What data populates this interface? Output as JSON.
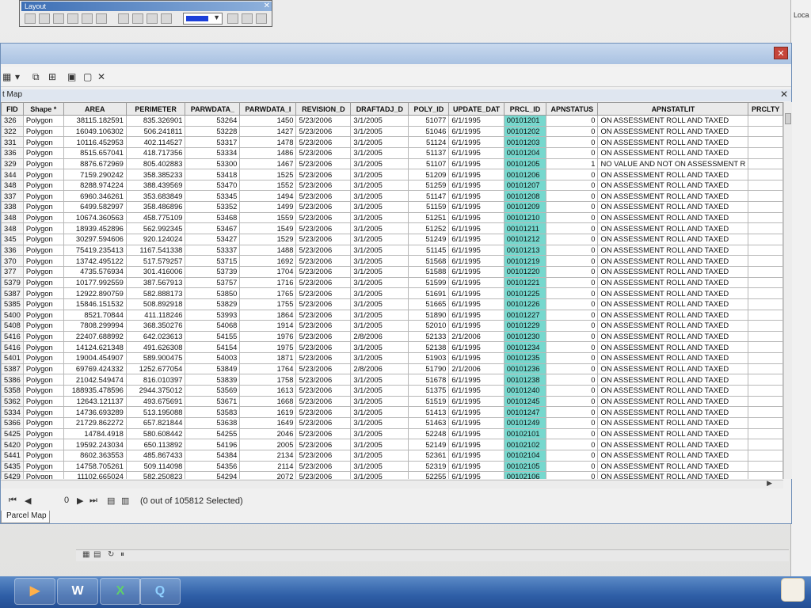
{
  "layout_toolbar": {
    "title": "Layout"
  },
  "right_panel": {
    "label": "Loca"
  },
  "attribute_window": {
    "tab_label": "Parcel Map",
    "short_title": "t Map",
    "status": "(0 out of 105812 Selected)",
    "record_nav_value": "0"
  },
  "columns": [
    "FID",
    "Shape *",
    "AREA",
    "PERIMETER",
    "PARWDATA_",
    "PARWDATA_I",
    "REVISION_D",
    "DRAFTADJ_D",
    "POLY_ID",
    "UPDATE_DAT",
    "PRCL_ID",
    "APNSTATUS",
    "APNSTATLIT",
    "PRCLTY"
  ],
  "rows": [
    [
      "326",
      "Polygon",
      "38115.182591",
      "835.326901",
      "53264",
      "1450",
      "5/23/2006",
      "3/1/2005",
      "51077",
      "6/1/1995",
      "00101201",
      "0",
      "ON ASSESSMENT ROLL AND TAXED"
    ],
    [
      "322",
      "Polygon",
      "16049.106302",
      "506.241811",
      "53228",
      "1427",
      "5/23/2006",
      "3/1/2005",
      "51046",
      "6/1/1995",
      "00101202",
      "0",
      "ON ASSESSMENT ROLL AND TAXED"
    ],
    [
      "331",
      "Polygon",
      "10116.452953",
      "402.114527",
      "53317",
      "1478",
      "5/23/2006",
      "3/1/2005",
      "51124",
      "6/1/1995",
      "00101203",
      "0",
      "ON ASSESSMENT ROLL AND TAXED"
    ],
    [
      "336",
      "Polygon",
      "8515.657041",
      "418.717356",
      "53334",
      "1486",
      "5/23/2006",
      "3/1/2005",
      "51137",
      "6/1/1995",
      "00101204",
      "0",
      "ON ASSESSMENT ROLL AND TAXED"
    ],
    [
      "329",
      "Polygon",
      "8876.672969",
      "805.402883",
      "53300",
      "1467",
      "5/23/2006",
      "3/1/2005",
      "51107",
      "6/1/1995",
      "00101205",
      "1",
      "NO VALUE AND NOT ON ASSESSMENT R"
    ],
    [
      "344",
      "Polygon",
      "7159.290242",
      "358.385233",
      "53418",
      "1525",
      "5/23/2006",
      "3/1/2005",
      "51209",
      "6/1/1995",
      "00101206",
      "0",
      "ON ASSESSMENT ROLL AND TAXED"
    ],
    [
      "348",
      "Polygon",
      "8288.974224",
      "388.439569",
      "53470",
      "1552",
      "5/23/2006",
      "3/1/2005",
      "51259",
      "6/1/1995",
      "00101207",
      "0",
      "ON ASSESSMENT ROLL AND TAXED"
    ],
    [
      "337",
      "Polygon",
      "6960.346261",
      "353.683849",
      "53345",
      "1494",
      "5/23/2006",
      "3/1/2005",
      "51147",
      "6/1/1995",
      "00101208",
      "0",
      "ON ASSESSMENT ROLL AND TAXED"
    ],
    [
      "338",
      "Polygon",
      "6499.582997",
      "358.486896",
      "53352",
      "1499",
      "5/23/2006",
      "3/1/2005",
      "51159",
      "6/1/1995",
      "00101209",
      "0",
      "ON ASSESSMENT ROLL AND TAXED"
    ],
    [
      "348",
      "Polygon",
      "10674.360563",
      "458.775109",
      "53468",
      "1559",
      "5/23/2006",
      "3/1/2005",
      "51251",
      "6/1/1995",
      "00101210",
      "0",
      "ON ASSESSMENT ROLL AND TAXED"
    ],
    [
      "348",
      "Polygon",
      "18939.452896",
      "562.992345",
      "53467",
      "1549",
      "5/23/2006",
      "3/1/2005",
      "51252",
      "6/1/1995",
      "00101211",
      "0",
      "ON ASSESSMENT ROLL AND TAXED"
    ],
    [
      "345",
      "Polygon",
      "30297.594606",
      "920.124024",
      "53427",
      "1529",
      "5/23/2006",
      "3/1/2005",
      "51249",
      "6/1/1995",
      "00101212",
      "0",
      "ON ASSESSMENT ROLL AND TAXED"
    ],
    [
      "336",
      "Polygon",
      "75419.235413",
      "1167.541338",
      "53337",
      "1488",
      "5/23/2006",
      "3/1/2005",
      "51145",
      "6/1/1995",
      "00101213",
      "0",
      "ON ASSESSMENT ROLL AND TAXED"
    ],
    [
      "370",
      "Polygon",
      "13742.495122",
      "517.579257",
      "53715",
      "1692",
      "5/23/2006",
      "3/1/2005",
      "51568",
      "6/1/1995",
      "00101219",
      "0",
      "ON ASSESSMENT ROLL AND TAXED"
    ],
    [
      "377",
      "Polygon",
      "4735.576934",
      "301.416006",
      "53739",
      "1704",
      "5/23/2006",
      "3/1/2005",
      "51588",
      "6/1/1995",
      "00101220",
      "0",
      "ON ASSESSMENT ROLL AND TAXED"
    ],
    [
      "5379",
      "Polygon",
      "10177.992559",
      "387.567913",
      "53757",
      "1716",
      "5/23/2006",
      "3/1/2005",
      "51599",
      "6/1/1995",
      "00101221",
      "0",
      "ON ASSESSMENT ROLL AND TAXED"
    ],
    [
      "5387",
      "Polygon",
      "12922.890759",
      "582.888173",
      "53850",
      "1765",
      "5/23/2006",
      "3/1/2005",
      "51691",
      "6/1/1995",
      "00101225",
      "0",
      "ON ASSESSMENT ROLL AND TAXED"
    ],
    [
      "5385",
      "Polygon",
      "15846.151532",
      "508.892918",
      "53829",
      "1755",
      "5/23/2006",
      "3/1/2005",
      "51665",
      "6/1/1995",
      "00101226",
      "0",
      "ON ASSESSMENT ROLL AND TAXED"
    ],
    [
      "5400",
      "Polygon",
      "8521.70844",
      "411.118246",
      "53993",
      "1864",
      "5/23/2006",
      "3/1/2005",
      "51890",
      "6/1/1995",
      "00101227",
      "0",
      "ON ASSESSMENT ROLL AND TAXED"
    ],
    [
      "5408",
      "Polygon",
      "7808.299994",
      "368.350276",
      "54068",
      "1914",
      "5/23/2006",
      "3/1/2005",
      "52010",
      "6/1/1995",
      "00101229",
      "0",
      "ON ASSESSMENT ROLL AND TAXED"
    ],
    [
      "5416",
      "Polygon",
      "22407.688992",
      "642.023613",
      "54155",
      "1976",
      "5/23/2006",
      "2/8/2006",
      "52133",
      "2/1/2006",
      "00101230",
      "0",
      "ON ASSESSMENT ROLL AND TAXED"
    ],
    [
      "5416",
      "Polygon",
      "14124.621348",
      "491.626308",
      "54154",
      "1975",
      "5/23/2006",
      "3/1/2005",
      "52138",
      "6/1/1995",
      "00101234",
      "0",
      "ON ASSESSMENT ROLL AND TAXED"
    ],
    [
      "5401",
      "Polygon",
      "19004.454907",
      "589.900475",
      "54003",
      "1871",
      "5/23/2006",
      "3/1/2005",
      "51903",
      "6/1/1995",
      "00101235",
      "0",
      "ON ASSESSMENT ROLL AND TAXED"
    ],
    [
      "5387",
      "Polygon",
      "69769.424332",
      "1252.677054",
      "53849",
      "1764",
      "5/23/2006",
      "2/8/2006",
      "51790",
      "2/1/2006",
      "00101236",
      "0",
      "ON ASSESSMENT ROLL AND TAXED"
    ],
    [
      "5386",
      "Polygon",
      "21042.549474",
      "816.010397",
      "53839",
      "1758",
      "5/23/2006",
      "3/1/2005",
      "51678",
      "6/1/1995",
      "00101238",
      "0",
      "ON ASSESSMENT ROLL AND TAXED"
    ],
    [
      "5358",
      "Polygon",
      "188935.478596",
      "2944.375012",
      "53569",
      "1613",
      "5/23/2006",
      "3/1/2005",
      "51375",
      "6/1/1995",
      "00101240",
      "0",
      "ON ASSESSMENT ROLL AND TAXED"
    ],
    [
      "5362",
      "Polygon",
      "12643.121137",
      "493.675691",
      "53671",
      "1668",
      "5/23/2006",
      "3/1/2005",
      "51519",
      "6/1/1995",
      "00101245",
      "0",
      "ON ASSESSMENT ROLL AND TAXED"
    ],
    [
      "5334",
      "Polygon",
      "14736.693289",
      "513.195088",
      "53583",
      "1619",
      "5/23/2006",
      "3/1/2005",
      "51413",
      "6/1/1995",
      "00101247",
      "0",
      "ON ASSESSMENT ROLL AND TAXED"
    ],
    [
      "5366",
      "Polygon",
      "21729.862272",
      "657.821844",
      "53638",
      "1649",
      "5/23/2006",
      "3/1/2005",
      "51463",
      "6/1/1995",
      "00101249",
      "0",
      "ON ASSESSMENT ROLL AND TAXED"
    ],
    [
      "5425",
      "Polygon",
      "14784.4918",
      "580.608442",
      "54255",
      "2046",
      "5/23/2006",
      "3/1/2005",
      "52248",
      "6/1/1995",
      "00102101",
      "0",
      "ON ASSESSMENT ROLL AND TAXED"
    ],
    [
      "5420",
      "Polygon",
      "19592.243034",
      "650.113892",
      "54196",
      "2005",
      "5/23/2006",
      "3/1/2005",
      "52149",
      "6/1/1995",
      "00102102",
      "0",
      "ON ASSESSMENT ROLL AND TAXED"
    ],
    [
      "5441",
      "Polygon",
      "8602.363553",
      "485.867433",
      "54384",
      "2134",
      "5/23/2006",
      "3/1/2005",
      "52361",
      "6/1/1995",
      "00102104",
      "0",
      "ON ASSESSMENT ROLL AND TAXED"
    ],
    [
      "5435",
      "Polygon",
      "14758.705261",
      "509.114098",
      "54356",
      "2114",
      "5/23/2006",
      "3/1/2005",
      "52319",
      "6/1/1995",
      "00102105",
      "0",
      "ON ASSESSMENT ROLL AND TAXED"
    ],
    [
      "5429",
      "Polygon",
      "11102.665024",
      "582.250823",
      "54294",
      "2072",
      "5/23/2006",
      "3/1/2005",
      "52255",
      "6/1/1995",
      "00102106",
      "0",
      "ON ASSESSMENT ROLL AND TAXED"
    ]
  ],
  "taskbar": {
    "apps": [
      "Media",
      "Word",
      "Excel",
      "Search"
    ],
    "labels": {
      "word": "W",
      "excel": "X",
      "search": "Q",
      "media": "▶"
    }
  }
}
